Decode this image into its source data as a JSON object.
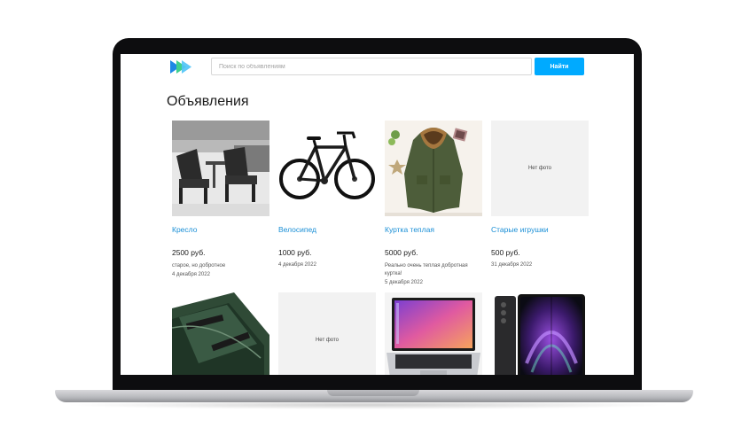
{
  "search": {
    "placeholder": "Поиск по объявлениям",
    "button_label": "Найти"
  },
  "page": {
    "title": "Объявления"
  },
  "listings": [
    {
      "title": "Кресло",
      "price": "2500 руб.",
      "description": "старое, но добротное",
      "date": "4 декабря 2022",
      "image": "armchairs-photo"
    },
    {
      "title": "Велосипед",
      "price": "1000 руб.",
      "description": "",
      "date": "4 декабря 2022",
      "image": "bicycle-photo"
    },
    {
      "title": "Куртка теплая",
      "price": "5000 руб.",
      "description": "Реально очень теплая добротная куртка!",
      "date": "5 декабря 2022",
      "image": "jacket-photo"
    },
    {
      "title": "Старые игрушки",
      "price": "500 руб.",
      "description": "",
      "date": "31 декабря 2022",
      "image": "",
      "no_photo": "Нет фото"
    },
    {
      "image": "boat-photo"
    },
    {
      "image": "",
      "no_photo": "Нет фото"
    },
    {
      "image": "laptop-photo"
    },
    {
      "image": "phone-photo"
    }
  ],
  "colors": {
    "accent": "#00aaff",
    "link": "#1a8fd6",
    "logo_green": "#3ecf8e",
    "logo_blue": "#1e88e5"
  }
}
